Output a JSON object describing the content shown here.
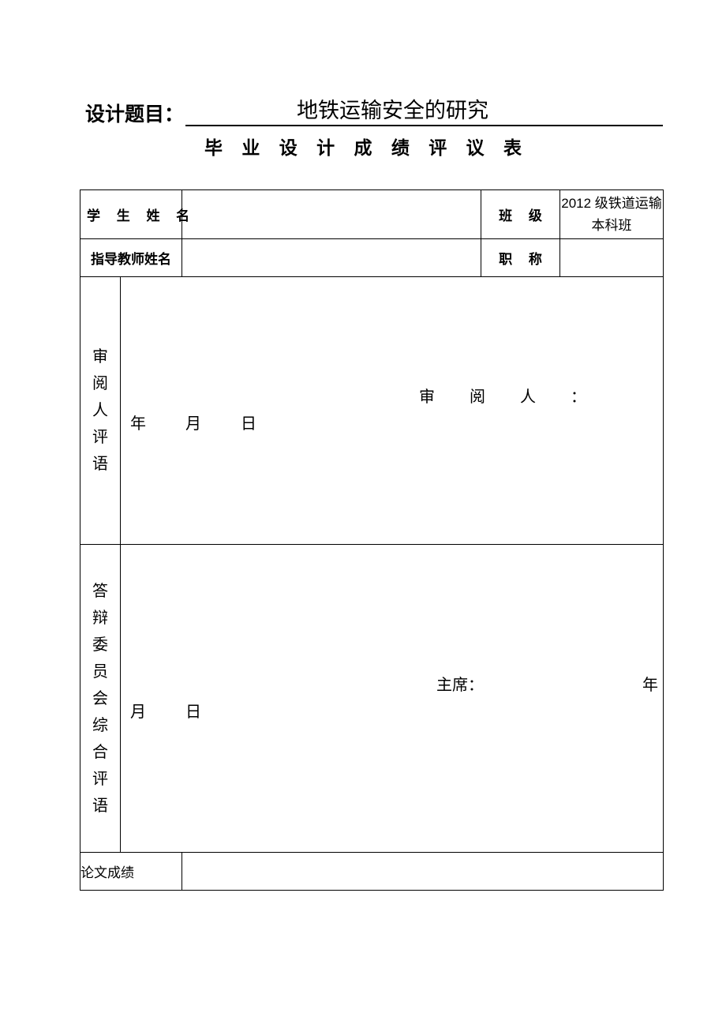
{
  "document": {
    "title_label": "设计题目：",
    "title_value": "地铁运输安全的研究",
    "form_title": "毕 业 设 计 成 绩 评 议 表"
  },
  "table": {
    "rows": {
      "student_name_label": "学 生 姓 名",
      "student_name_value": "",
      "class_label": "班 级",
      "class_value": "2012 级铁道运输本科班",
      "advisor_name_label": "指导教师姓名",
      "advisor_name_value": "",
      "title_rank_label": "职 称",
      "title_rank_value": "",
      "reviewer_comment_label": "审阅人评语",
      "reviewer_comment_body": "",
      "reviewer_sign_label": "审阅人：",
      "reviewer_date_label": "年月日",
      "committee_comment_label": "答辩委员会综合评语",
      "committee_comment_body": "",
      "chair_sign_label": "主席：",
      "chair_date_year": "年",
      "chair_date_monthday": "月日",
      "thesis_score_label": "论文成绩",
      "thesis_score_value": ""
    }
  },
  "colors": {
    "border": "#000000",
    "text": "#000000",
    "background": "#ffffff"
  }
}
